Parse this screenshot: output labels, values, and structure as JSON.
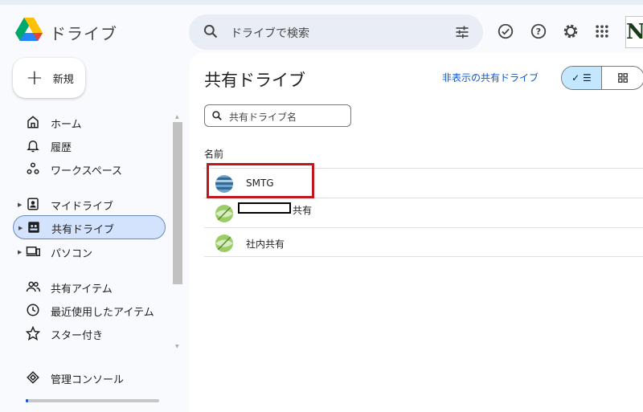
{
  "header": {
    "brand": "ドライブ",
    "search_placeholder": "ドライブで検索",
    "icons": [
      "google-drive-logo",
      "search-icon",
      "tune-icon",
      "offline-check-icon",
      "help-icon",
      "settings-icon",
      "apps-grid-icon"
    ],
    "account_initial": "N"
  },
  "sidebar": {
    "new_button": "新規",
    "items": [
      {
        "label": "ホーム",
        "icon": "home-icon"
      },
      {
        "label": "履歴",
        "icon": "bell-icon"
      },
      {
        "label": "ワークスペース",
        "icon": "workspaces-icon"
      },
      {
        "label": "マイドライブ",
        "icon": "my-drive-icon"
      },
      {
        "label": "共有ドライブ",
        "icon": "shared-drives-icon",
        "active": true
      },
      {
        "label": "パソコン",
        "icon": "computers-icon"
      },
      {
        "label": "共有アイテム",
        "icon": "shared-people-icon"
      },
      {
        "label": "最近使用したアイテム",
        "icon": "clock-icon"
      },
      {
        "label": "スター付き",
        "icon": "star-icon"
      },
      {
        "label": "管理コンソール",
        "icon": "admin-icon"
      }
    ],
    "storage_fraction": 0.02
  },
  "main": {
    "title": "共有ドライブ",
    "hidden_link": "非表示の共有ドライブ",
    "view_toggle": {
      "list_glyph": "✓ ☰",
      "selected": "list"
    },
    "filter_placeholder": "共有ドライブ名",
    "column_header": "名前",
    "rows": [
      {
        "name": "SMTG",
        "icon": "drive-stripes-blue",
        "highlighted": true
      },
      {
        "name": "共有",
        "icon": "drive-leaf-green",
        "redacted_prefix": true
      },
      {
        "name": "社内共有",
        "icon": "drive-leaf-green"
      }
    ]
  },
  "colors": {
    "accent_blue": "#0b57d0",
    "active_nav": "#d3e3fd",
    "toggle_selected": "#c2e7ff",
    "highlight_red": "#c0171c"
  }
}
